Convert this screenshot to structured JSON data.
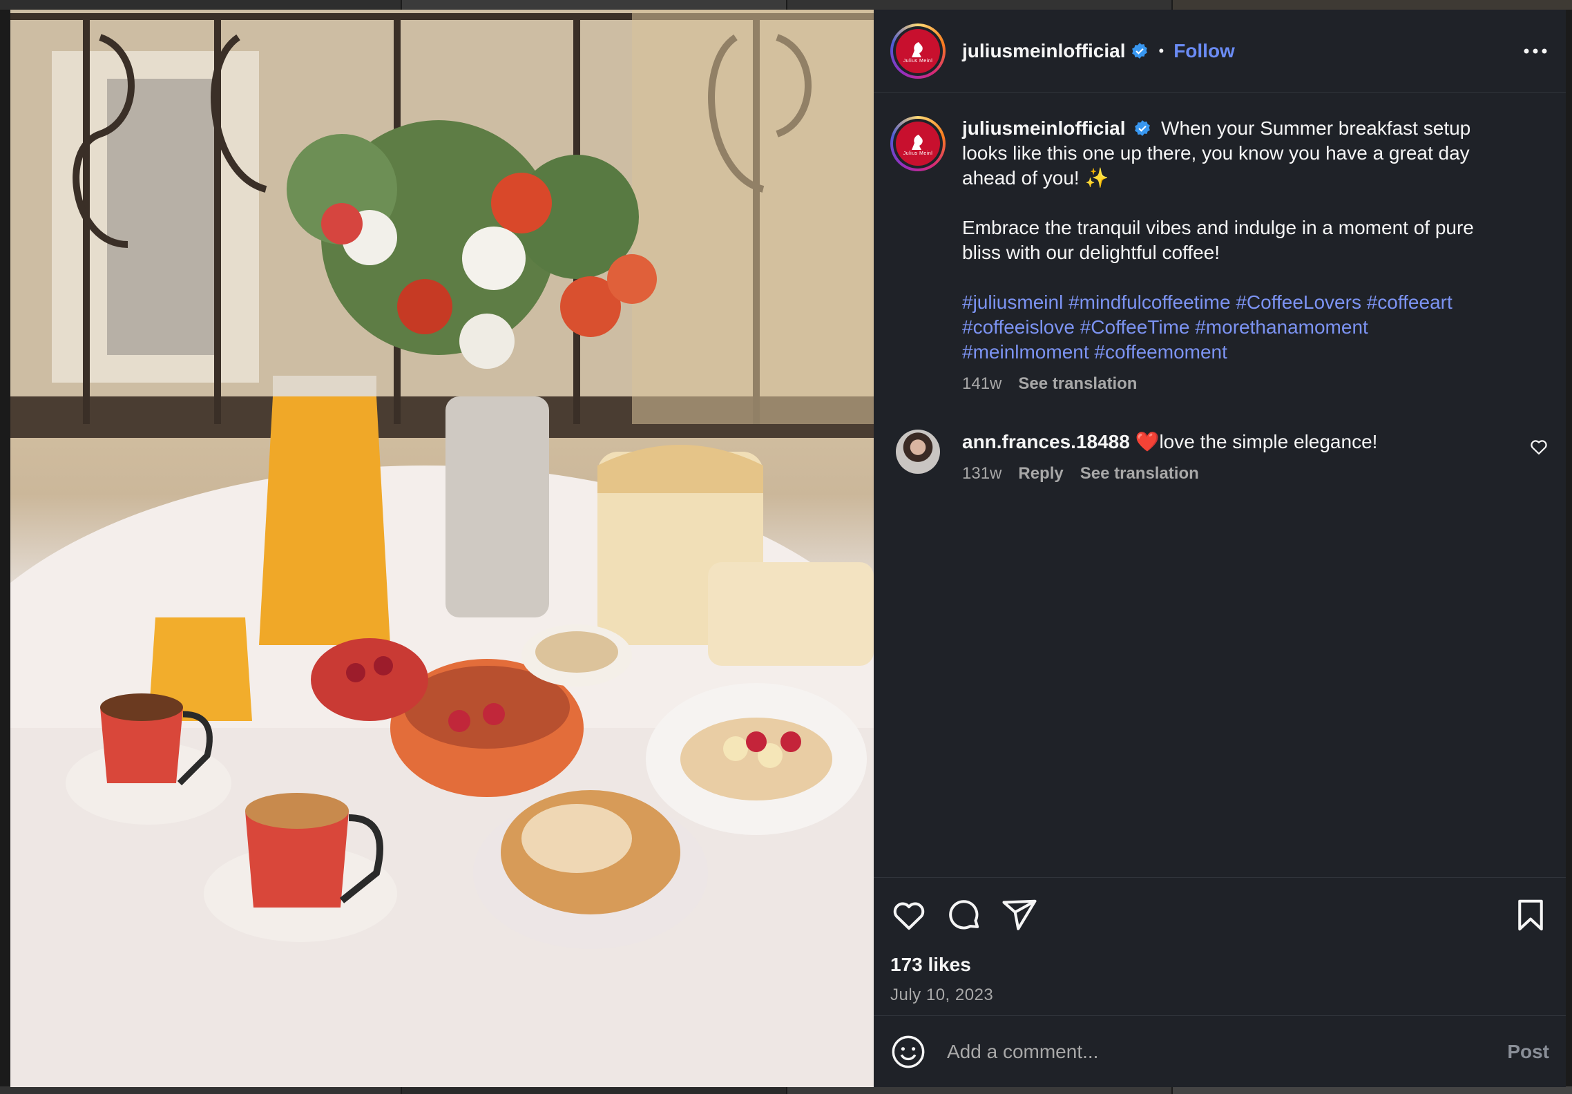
{
  "post": {
    "account": "juliusmeinlofficial",
    "follow_label": "Follow",
    "separator": "•",
    "avatar_logo_text": "Julius Meinl",
    "caption_lines": [
      "When your Summer breakfast setup",
      "looks like this one up there, you know you have a great day",
      "ahead of you! ✨"
    ],
    "caption_paragraph2": [
      "Embrace the tranquil vibes and indulge in a moment of pure",
      "bliss with our delightful coffee!"
    ],
    "hashtag_lines": [
      "#juliusmeinl #mindfulcoffeetime #CoffeeLovers #coffeeart",
      "#coffeeislove #CoffeeTime #morethanamoment",
      "#meinlmoment #coffeemoment"
    ],
    "age": "141w",
    "see_translation": "See translation",
    "likes": "173 likes",
    "date": "July 10, 2023"
  },
  "comment": {
    "user": "ann.frances.18488",
    "text": "❤️love the simple elegance!",
    "age": "131w",
    "reply_label": "Reply",
    "see_translation": "See translation"
  },
  "composer": {
    "placeholder": "Add a comment...",
    "post_label": "Post"
  },
  "icons": [
    "more-options-icon",
    "verified-badge-icon",
    "like-icon",
    "comment-icon",
    "share-icon",
    "save-icon",
    "emoji-icon",
    "comment-like-icon"
  ],
  "colors": {
    "link": "#7c93f2",
    "panel": "#1f2228",
    "brand_red": "#c8102e"
  }
}
